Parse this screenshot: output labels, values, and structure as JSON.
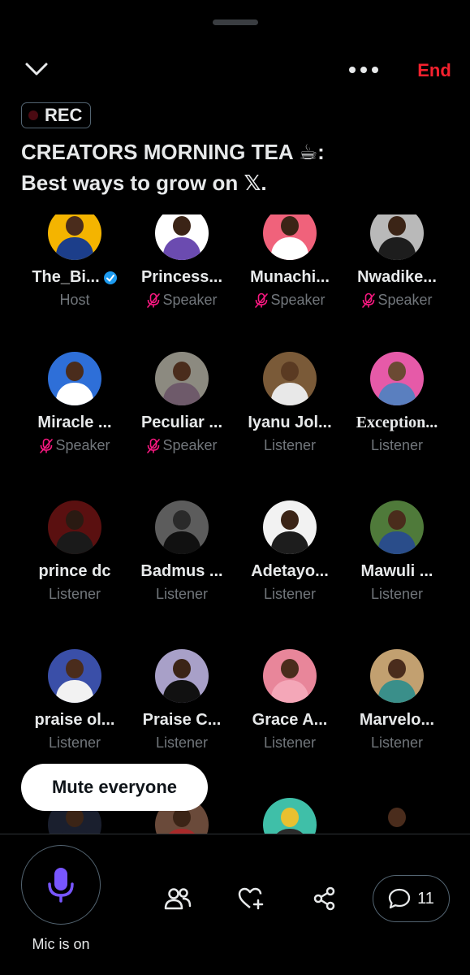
{
  "header": {
    "end_label": "End",
    "rec_label": "REC",
    "title": "CREATORS MORNING TEA ☕:\nBest ways to grow on 𝕏."
  },
  "participants": [
    {
      "name": "The_Bi...",
      "role": "Host",
      "verified": true,
      "muted": false,
      "avatar_bg": "#f4b400",
      "head": "#4a2c1c",
      "body": "#1c3e8a"
    },
    {
      "name": "Princess...",
      "role": "Speaker",
      "verified": false,
      "muted": true,
      "avatar_bg": "#ffffff",
      "head": "#3b2416",
      "body": "#6b4bb0"
    },
    {
      "name": "Munachi...",
      "role": "Speaker",
      "verified": false,
      "muted": true,
      "avatar_bg": "#f0627b",
      "head": "#3b2416",
      "body": "#ffffff"
    },
    {
      "name": "Nwadike...",
      "role": "Speaker",
      "verified": false,
      "muted": true,
      "avatar_bg": "#b9b9b9",
      "head": "#3b2416",
      "body": "#1d1d1d"
    },
    {
      "name": "Miracle ...",
      "role": "Speaker",
      "verified": false,
      "muted": true,
      "avatar_bg": "#2e6fd8",
      "head": "#4a2c1c",
      "body": "#ffffff"
    },
    {
      "name": "Peculiar ...",
      "role": "Speaker",
      "verified": false,
      "muted": true,
      "avatar_bg": "#8c8a80",
      "head": "#4a2c1c",
      "body": "#6e5a6a"
    },
    {
      "name": "Iyanu Jol...",
      "role": "Listener",
      "verified": false,
      "muted": false,
      "avatar_bg": "#7a5a38",
      "head": "#5a3a22",
      "body": "#e8e8e8"
    },
    {
      "name": "Exception...",
      "role": "Listener",
      "verified": false,
      "muted": false,
      "serif": true,
      "avatar_bg": "#e65aa8",
      "head": "#6b4a33",
      "body": "#5a7fbf"
    },
    {
      "name": "prince dc",
      "role": "Listener",
      "verified": false,
      "muted": false,
      "avatar_bg": "#5a1010",
      "head": "#2a1a12",
      "body": "#1a1a1a"
    },
    {
      "name": "Badmus ...",
      "role": "Listener",
      "verified": false,
      "muted": false,
      "avatar_bg": "#5c5c5c",
      "head": "#2a2a2a",
      "body": "#111111"
    },
    {
      "name": "Adetayo...",
      "role": "Listener",
      "verified": false,
      "muted": false,
      "avatar_bg": "#f2f2f2",
      "head": "#3b2416",
      "body": "#1d1d1d"
    },
    {
      "name": "Mawuli ...",
      "role": "Listener",
      "verified": false,
      "muted": false,
      "avatar_bg": "#4f7a3a",
      "head": "#4a2c1c",
      "body": "#2a4d8a"
    },
    {
      "name": "praise ol...",
      "role": "Listener",
      "verified": false,
      "muted": false,
      "avatar_bg": "#3a4fa8",
      "head": "#4a2c1c",
      "body": "#f2f2f2"
    },
    {
      "name": "Praise C...",
      "role": "Listener",
      "verified": false,
      "muted": false,
      "avatar_bg": "#a8a0c8",
      "head": "#3b2416",
      "body": "#111111"
    },
    {
      "name": "Grace A...",
      "role": "Listener",
      "verified": false,
      "muted": false,
      "avatar_bg": "#e8869a",
      "head": "#4a2c1c",
      "body": "#f4a7b8"
    },
    {
      "name": "Marvelo...",
      "role": "Listener",
      "verified": false,
      "muted": false,
      "avatar_bg": "#c2a070",
      "head": "#4a2c1c",
      "body": "#3a8f8a"
    },
    {
      "name": "",
      "role": "",
      "verified": false,
      "muted": false,
      "avatar_bg": "#1a1f2e",
      "head": "#3b2416",
      "body": "#1a1f2e"
    },
    {
      "name": "",
      "role": "",
      "verified": false,
      "muted": false,
      "avatar_bg": "#6a4a3a",
      "head": "#3b2416",
      "body": "#a82a2a"
    },
    {
      "name": "",
      "role": "",
      "verified": false,
      "muted": false,
      "avatar_bg": "#3fbfa8",
      "head": "#e8c030",
      "body": "#2a2a2a"
    },
    {
      "name": "",
      "role": "",
      "verified": false,
      "muted": false,
      "avatar_bg": "#000000",
      "head": "#4a2c1c",
      "body": "#000000"
    }
  ],
  "mute_everyone_label": "Mute everyone",
  "footer": {
    "mic_label": "Mic is on",
    "comment_count": "11"
  },
  "colors": {
    "accent_end": "#f4212e",
    "mic": "#7856ff",
    "verified": "#1d9bf0",
    "muted_icon": "#f91880"
  }
}
